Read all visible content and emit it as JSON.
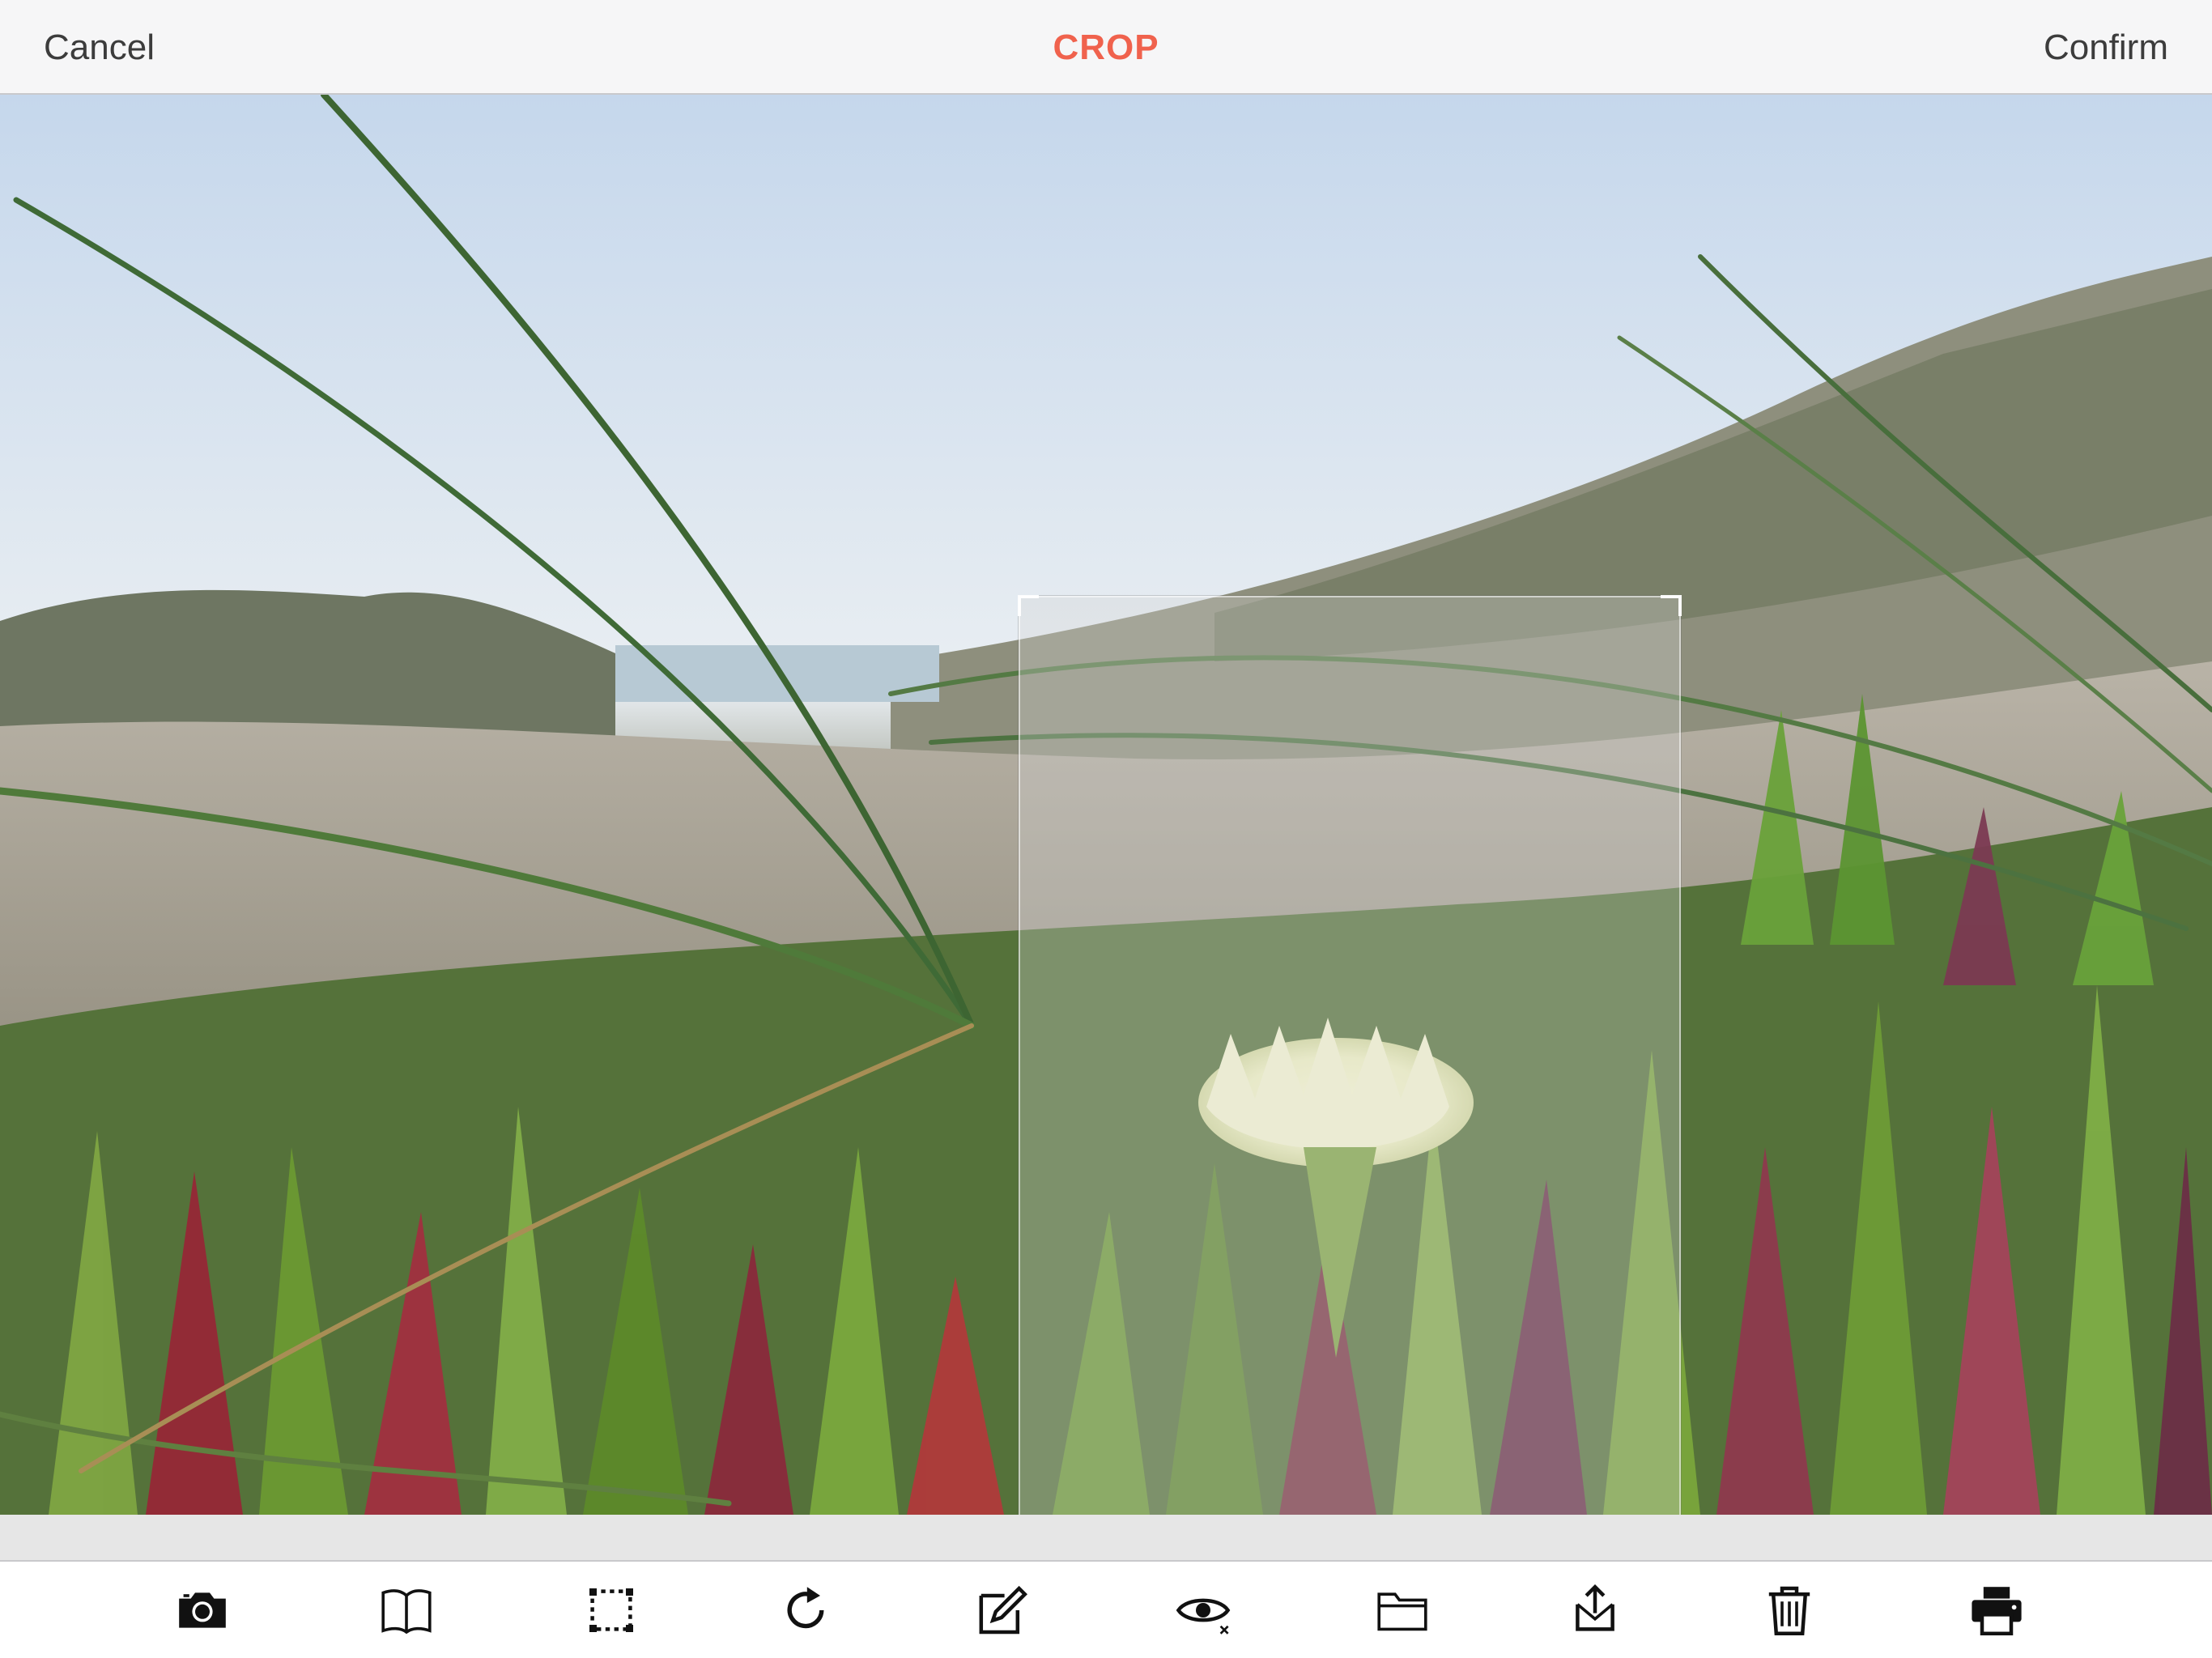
{
  "navbar": {
    "cancel_label": "Cancel",
    "title": "CROP",
    "confirm_label": "Confirm",
    "title_color": "#f0624d",
    "label_color": "#3c3c3c"
  },
  "photo": {
    "subject": "yellow iceplant flower among succulents and beach grass on sand dunes"
  },
  "crop": {
    "state": "active"
  },
  "toolbar": {
    "items": [
      {
        "icon": "camera-icon"
      },
      {
        "icon": "book-icon"
      },
      {
        "icon": "crop-selection-icon"
      },
      {
        "icon": "rotate-icon"
      },
      {
        "icon": "edit-icon"
      },
      {
        "icon": "eye-icon"
      },
      {
        "icon": "folder-icon"
      },
      {
        "icon": "export-icon"
      },
      {
        "icon": "trash-icon"
      },
      {
        "icon": "print-icon"
      }
    ]
  }
}
